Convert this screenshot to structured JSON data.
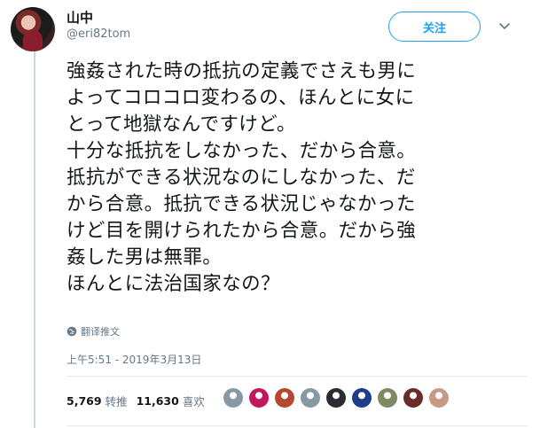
{
  "author": {
    "display_name": "山中",
    "screen_name": "@eri82tom"
  },
  "follow_button_label": "关注",
  "tweet": {
    "lines": [
      "強姦された時の抵抗の定義でさえも男に",
      "よってコロコロ変わるの、ほんとに女に",
      "とって地獄なんですけど。",
      "十分な抵抗をしなかった、だから合意。",
      "抵抗ができる状況なのにしなかった、だ",
      "から合意。抵抗できる状況じゃなかった",
      "けど目を開けられたから合意。だから強",
      "姦した男は無罪。",
      "ほんとに法治国家なの？"
    ]
  },
  "translate_label": "翻译推文",
  "timestamp": "上午5:51 - 2019年3月13日",
  "stats": {
    "retweets_count": "5,769",
    "retweets_label": "转推",
    "likes_count": "11,630",
    "likes_label": "喜欢"
  },
  "likers": [
    {
      "name": "liker-1",
      "color": "#8899a6"
    },
    {
      "name": "liker-2",
      "color": "#c2185b"
    },
    {
      "name": "liker-3",
      "color": "#b5482f"
    },
    {
      "name": "liker-4",
      "color": "#8899a6"
    },
    {
      "name": "liker-5",
      "color": "#2b2b33"
    },
    {
      "name": "liker-6",
      "color": "#1f3c8a"
    },
    {
      "name": "liker-7",
      "color": "#7f8a63"
    },
    {
      "name": "liker-8",
      "color": "#6b2b2b"
    },
    {
      "name": "liker-9",
      "color": "#c79a86"
    }
  ]
}
